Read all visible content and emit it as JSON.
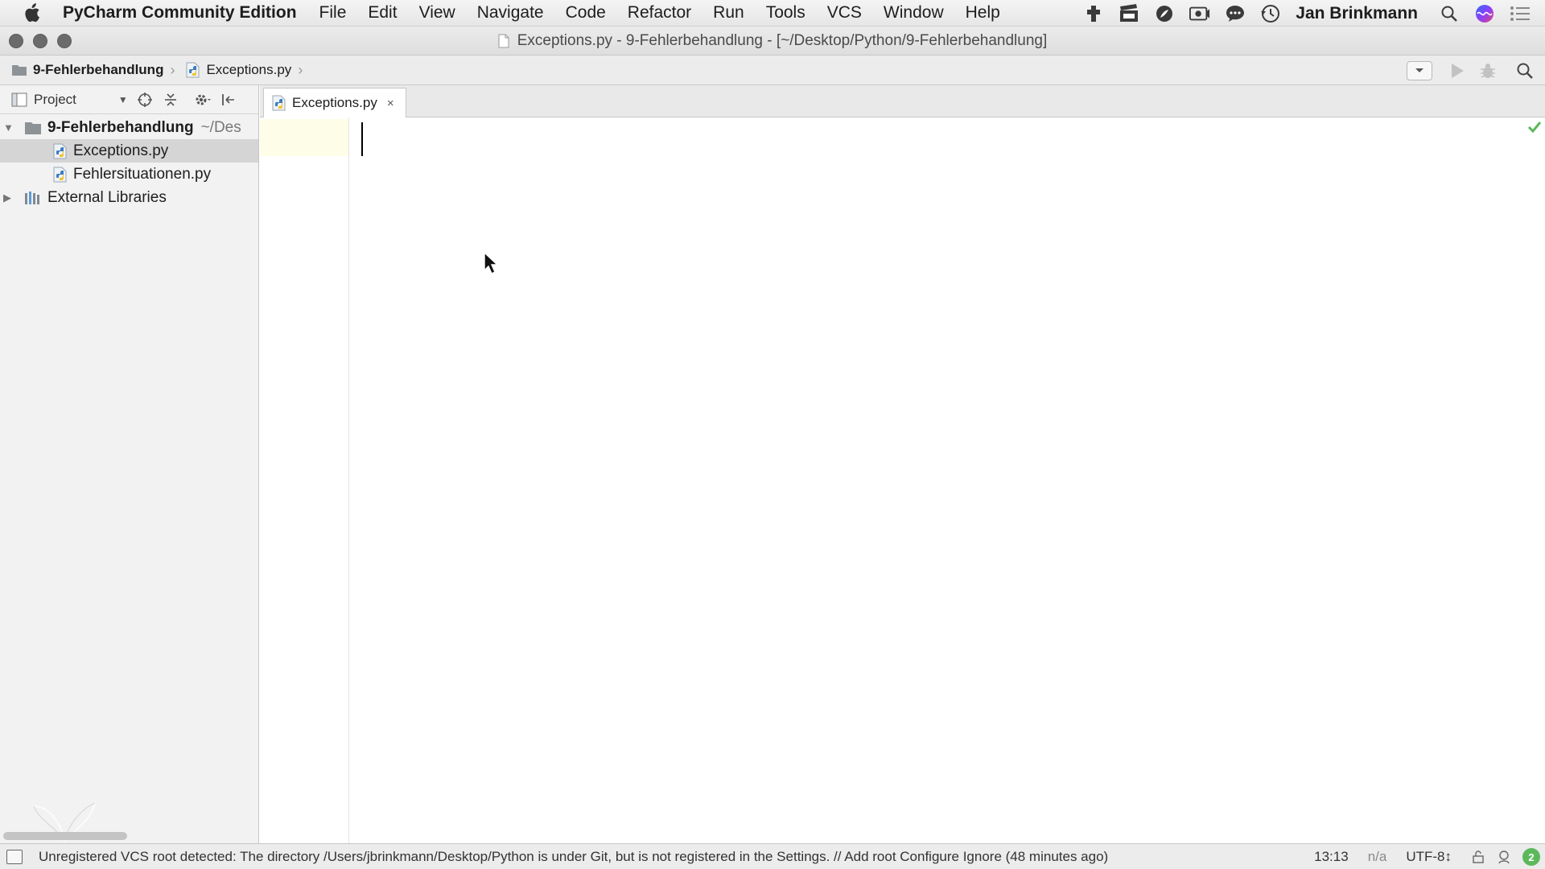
{
  "menubar": {
    "app_name": "PyCharm Community Edition",
    "items": [
      "File",
      "Edit",
      "View",
      "Navigate",
      "Code",
      "Refactor",
      "Run",
      "Tools",
      "VCS",
      "Window",
      "Help"
    ],
    "user_name": "Jan Brinkmann",
    "status_icons": [
      "extension-icon",
      "video-clapper-icon",
      "leaf-icon",
      "screen-record-icon",
      "chat-bubble-icon",
      "time-machine-icon",
      "spotlight-search-icon",
      "siri-icon",
      "notification-center-icon"
    ]
  },
  "window": {
    "title": "Exceptions.py - 9-Fehlerbehandlung - [~/Desktop/Python/9-Fehlerbehandlung]"
  },
  "navbar": {
    "breadcrumbs": [
      {
        "label": "9-Fehlerbehandlung",
        "icon": "folder-icon"
      },
      {
        "label": "Exceptions.py",
        "icon": "python-file-icon"
      }
    ]
  },
  "project": {
    "title": "Project",
    "tree": {
      "root": {
        "label": "9-Fehlerbehandlung",
        "hint": "~/Des"
      },
      "files": [
        "Exceptions.py",
        "Fehlersituationen.py"
      ],
      "external": "External Libraries"
    }
  },
  "editor": {
    "tab_label": "Exceptions.py",
    "tab_close": "×"
  },
  "statusbar": {
    "message": "Unregistered VCS root detected: The directory /Users/jbrinkmann/Desktop/Python is under Git, but is not registered in the Settings. // Add root  Configure  Ignore (48 minutes ago)",
    "position": "13:13",
    "line_separator": "n/a",
    "encoding": "UTF-8↕",
    "event_count": "2"
  },
  "colors": {
    "accent_green": "#5cb85c",
    "current_line": "#fefde8",
    "selection": "#d5d5d5"
  }
}
